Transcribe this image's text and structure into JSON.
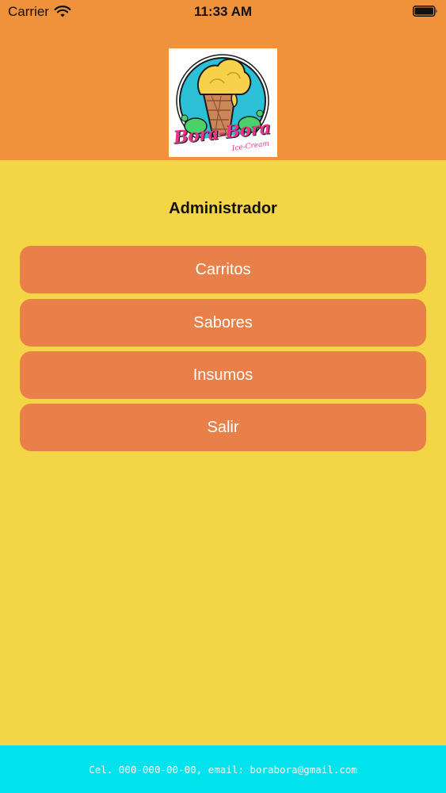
{
  "status_bar": {
    "carrier": "Carrier",
    "time": "11:33 AM",
    "wifi_icon": "wifi-icon",
    "battery_icon": "battery-icon"
  },
  "logo": {
    "line1": "Bora-Bora",
    "line2": "Ice-Cream"
  },
  "page": {
    "title": "Administrador"
  },
  "menu": {
    "items": [
      {
        "label": "Carritos"
      },
      {
        "label": "Sabores"
      },
      {
        "label": "Insumos"
      },
      {
        "label": "Salir"
      }
    ]
  },
  "footer": {
    "text": "Cel. 000-000-00-00, email: borabora@gmail.com"
  },
  "colors": {
    "header_bg": "#f0913c",
    "body_bg": "#f3d545",
    "button_bg": "#e97f49",
    "footer_bg": "#00e2ec"
  }
}
